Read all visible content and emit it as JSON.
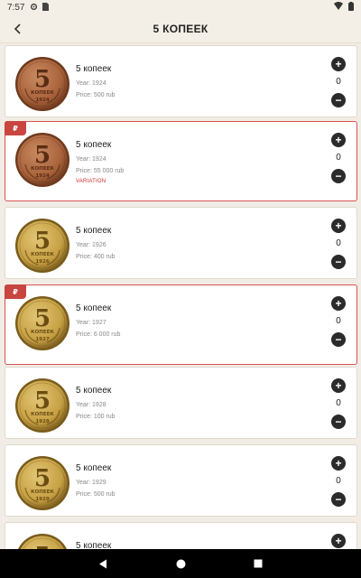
{
  "status_bar": {
    "time": "7:57",
    "left_icons": [
      "settings-icon",
      "sim-icon"
    ],
    "right_icons": [
      "wifi-icon",
      "battery-icon"
    ]
  },
  "header": {
    "title": "5 КОПЕЕК",
    "back_icon": "arrow-left-icon"
  },
  "coins": [
    {
      "name": "5 копеек",
      "year": "Year: 1924",
      "price": "Price: 500 rub",
      "count": "0",
      "variation": "",
      "tag": "",
      "coin_digit": "5",
      "coin_word": "КОПЕЕК",
      "coin_year": "1924",
      "metal": "copper"
    },
    {
      "name": "5 копеек",
      "year": "Year: 1924",
      "price": "Price: 55 000 rub",
      "count": "0",
      "variation": "VARIATION",
      "tag": "₽",
      "coin_digit": "5",
      "coin_word": "КОПЕЕК",
      "coin_year": "1924",
      "metal": "copper"
    },
    {
      "name": "5 копеек",
      "year": "Year: 1926",
      "price": "Price: 400 rub",
      "count": "0",
      "variation": "",
      "tag": "",
      "coin_digit": "5",
      "coin_word": "КОПЕЕК",
      "coin_year": "1926",
      "metal": "brass"
    },
    {
      "name": "5 копеек",
      "year": "Year: 1927",
      "price": "Price: 6 000 rub",
      "count": "0",
      "variation": "",
      "tag": "₽",
      "coin_digit": "5",
      "coin_word": "КОПЕЕК",
      "coin_year": "1927",
      "metal": "brass"
    },
    {
      "name": "5 копеек",
      "year": "Year: 1928",
      "price": "Price: 100 rub",
      "count": "0",
      "variation": "",
      "tag": "",
      "coin_digit": "5",
      "coin_word": "КОПЕЕК",
      "coin_year": "1928",
      "metal": "brass"
    },
    {
      "name": "5 копеек",
      "year": "Year: 1929",
      "price": "Price: 500 rub",
      "count": "0",
      "variation": "",
      "tag": "",
      "coin_digit": "5",
      "coin_word": "КОПЕЕК",
      "coin_year": "1929",
      "metal": "brass"
    },
    {
      "name": "5 копеек",
      "year": "",
      "price": "",
      "count": "",
      "variation": "",
      "tag": "",
      "coin_digit": "5",
      "coin_word": "",
      "coin_year": "",
      "metal": "brass"
    }
  ],
  "buttons": {
    "plus_label": "+",
    "minus_label": "−"
  },
  "colors": {
    "background": "#f1ede6",
    "card": "#ffffff",
    "accent_red": "#c9453f",
    "copper": "#a8603a",
    "brass": "#c9a447"
  },
  "nav_bar": {
    "icons": [
      "back-triangle-icon",
      "home-circle-icon",
      "recents-square-icon"
    ]
  }
}
